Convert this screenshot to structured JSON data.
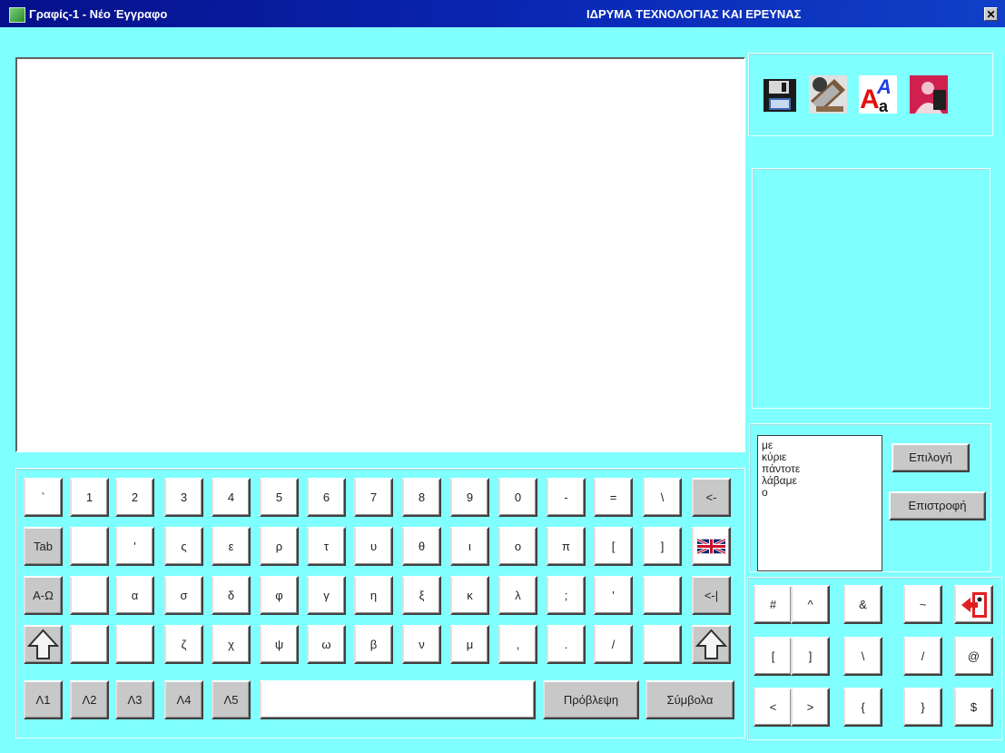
{
  "titlebar": {
    "document_title": "Γραφίς-1 - Νέο Έγγραφο",
    "organization": "ΙΔΡΥΜΑ ΤΕΧΝΟΛΟΓΙΑΣ ΚΑΙ ΕΡΕΥΝΑΣ",
    "close_glyph": "✕"
  },
  "editor": {
    "value": ""
  },
  "toolbar": {
    "icons": [
      "floppy-disk-icon",
      "print-icon",
      "font-style-icon",
      "user-profile-icon"
    ]
  },
  "suggestions": {
    "words": [
      "με",
      "κύριε",
      "πάντοτε",
      "λάβαμε",
      "ο"
    ],
    "select_label": "Επιλογή",
    "return_label": "Επιστροφή"
  },
  "keyboard": {
    "row1": [
      "`",
      "1",
      "2",
      "3",
      "4",
      "5",
      "6",
      "7",
      "8",
      "9",
      "0",
      "-",
      "=",
      "\\",
      "<-"
    ],
    "row2": [
      "Tab",
      "",
      "'",
      "ς",
      "ε",
      "ρ",
      "τ",
      "υ",
      "θ",
      "ι",
      "ο",
      "π",
      "[",
      "]"
    ],
    "row3": [
      "Α-Ω",
      "",
      "α",
      "σ",
      "δ",
      "φ",
      "γ",
      "η",
      "ξ",
      "κ",
      "λ",
      ";",
      "'",
      "",
      "<-|"
    ],
    "row4": [
      "",
      "",
      "ζ",
      "χ",
      "ψ",
      "ω",
      "β",
      "ν",
      "μ",
      ",",
      ".",
      "/",
      ""
    ],
    "row5": [
      "Λ1",
      "Λ2",
      "Λ3",
      "Λ4",
      "Λ5"
    ],
    "space_value": "",
    "predict_label": "Πρόβλεψη",
    "symbols_label": "Σύμβολα",
    "language_icon": "uk-flag-icon",
    "shift_icon": "shift-arrow-icon"
  },
  "symbols": {
    "row1": [
      "#",
      "^",
      "&",
      "~"
    ],
    "row2": [
      "[",
      "]",
      "\\",
      "/",
      "@"
    ],
    "row3": [
      "<",
      ">",
      "{",
      "}",
      "$"
    ],
    "exit_icon": "exit-door-icon"
  }
}
